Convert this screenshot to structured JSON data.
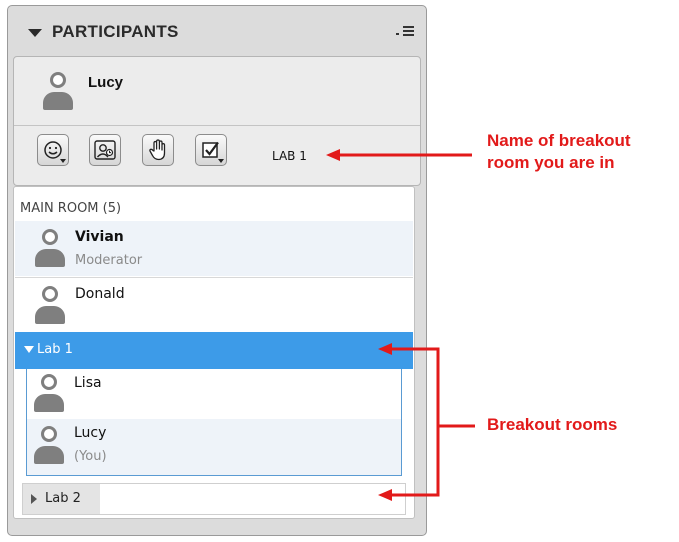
{
  "panel": {
    "title": "PARTICIPANTS"
  },
  "user": {
    "name": "Lucy",
    "room_label": "LAB 1"
  },
  "room": {
    "title": "MAIN ROOM (5)",
    "participants": [
      {
        "name": "Vivian",
        "role": "Moderator"
      },
      {
        "name": "Donald",
        "role": ""
      }
    ]
  },
  "breakout": {
    "lab1": {
      "label": "Lab 1",
      "members": [
        {
          "name": "Lisa",
          "note": ""
        },
        {
          "name": "Lucy",
          "note": "(You)"
        }
      ]
    },
    "lab2": {
      "label": "Lab 2"
    }
  },
  "annotations": {
    "room_name_line1": "Name of breakout",
    "room_name_line2": "room you are in",
    "breakout_rooms": "Breakout rooms"
  },
  "colors": {
    "accent": "#3d9be8",
    "annotation": "#e21a1a"
  }
}
